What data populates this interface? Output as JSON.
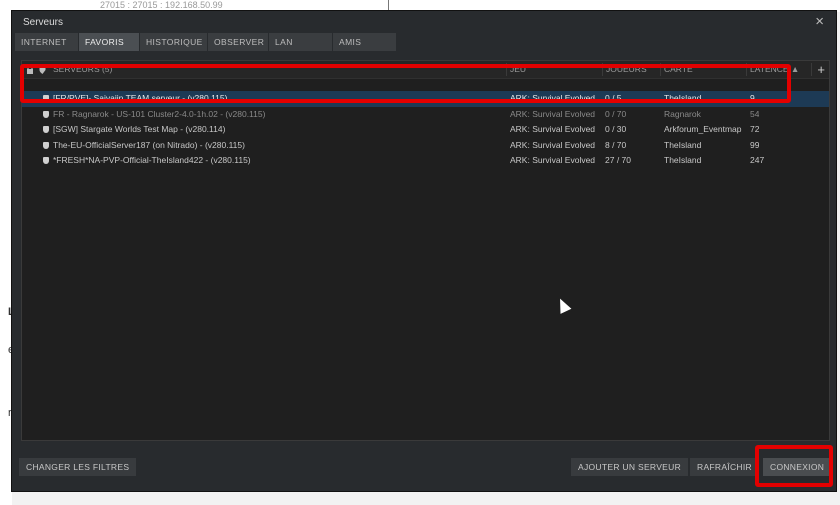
{
  "window": {
    "title": "Serveurs",
    "close_glyph": "×"
  },
  "tabs": [
    "INTERNET",
    "FAVORIS",
    "HISTORIQUE",
    "OBSERVER",
    "LAN",
    "AMIS"
  ],
  "active_tab": "FAVORIS",
  "table": {
    "headers": {
      "servers": "SERVEURS (5)",
      "game": "JEU",
      "players": "JOUEURS",
      "map": "CARTE",
      "latency": "LATENCE ▲",
      "add": "+"
    },
    "rows": [
      {
        "name": "[FR/PVE]- Saiyajin TEAM serveur - (v280.115)",
        "game": "ARK: Survival Evolved",
        "players": "0 / 5",
        "map": "TheIsland",
        "latency": "9"
      },
      {
        "name": "FR - Ragnarok - US-101 Cluster2-4.0-1h.02 - (v280.115)",
        "game": "ARK: Survival Evolved",
        "players": "0 / 70",
        "map": "Ragnarok",
        "latency": "54"
      },
      {
        "name": "[SGW] Stargate Worlds Test Map - (v280.114)",
        "game": "ARK: Survival Evolved",
        "players": "0 / 30",
        "map": "Arkforum_Eventmap",
        "latency": "72"
      },
      {
        "name": "The-EU-OfficialServer187 (on Nitrado) - (v280.115)",
        "game": "ARK: Survival Evolved",
        "players": "8 / 70",
        "map": "TheIsland",
        "latency": "99"
      },
      {
        "name": "*FRESH*NA-PVP-Official-TheIsland422 - (v280.115)",
        "game": "ARK: Survival Evolved",
        "players": "27 / 70",
        "map": "TheIsland",
        "latency": "247"
      }
    ]
  },
  "buttons": {
    "filters": "CHANGER LES FILTRES",
    "add_server": "AJOUTER UN SERVEUR",
    "refresh": "RAFRAÎCHIR",
    "connect": "CONNEXION"
  },
  "background": {
    "top_text": "27015 : 27015 : 192.168.50.99",
    "frag1": "L",
    "frag2": "e",
    "frag3": "r"
  },
  "icons": {
    "lock": "lock-icon",
    "shield": "shield-icon",
    "add": "plus-icon"
  }
}
